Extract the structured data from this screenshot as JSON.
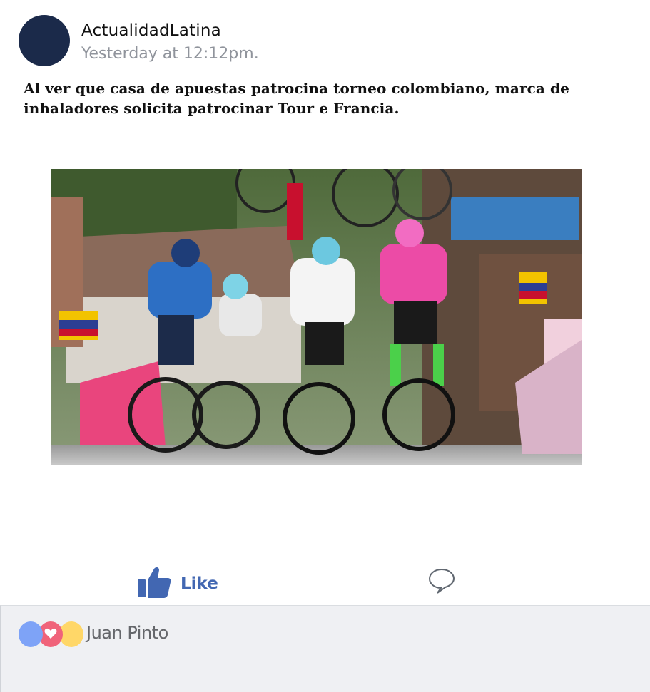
{
  "post": {
    "author": "ActualidadLatina",
    "timestamp": "Yesterday at 12:12pm.",
    "text": "Al ver que casa de apuestas patrocina torneo colombiano, marca de inhaladores solicita patrocinar Tour e Francia."
  },
  "actions": {
    "like_label": "Like",
    "like_icon": "thumbs-up-icon",
    "comment_icon": "speech-bubble-icon"
  },
  "reactions": {
    "icons": [
      "like-reaction-icon",
      "love-reaction-icon",
      "haha-reaction-icon"
    ],
    "reactor_name": "Juan Pinto"
  },
  "colors": {
    "avatar": "#1b2a4a",
    "like_blue": "#4267b2",
    "reaction_bar": "#eff0f3",
    "reaction_like": "#7ea3f7",
    "reaction_love": "#f0637a",
    "reaction_haha": "#ffd768"
  }
}
